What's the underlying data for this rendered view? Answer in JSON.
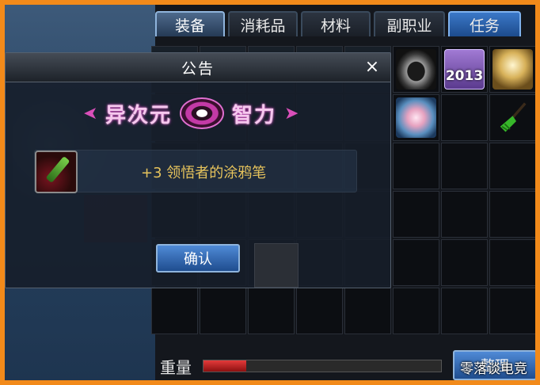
{
  "tabs": [
    {
      "label": "装备",
      "active": true
    },
    {
      "label": "消耗品",
      "active": false
    },
    {
      "label": "材料",
      "active": false
    },
    {
      "label": "副职业",
      "active": false
    },
    {
      "label": "任务",
      "active": false
    }
  ],
  "inventory": {
    "items": [
      "belt-icon",
      "badge-2013-icon",
      "trophy-icon",
      "orb-icon",
      "broom-icon"
    ],
    "badge_text": "2013"
  },
  "modal": {
    "title": "公告",
    "close_glyph": "×",
    "banner": {
      "left": "异次元",
      "right": "智力",
      "arrow_left": "➤",
      "arrow_right": "➤"
    },
    "reward_text": "+3 领悟者的涂鸦笔",
    "confirm_label": "确认"
  },
  "footer": {
    "weight_label": "重量",
    "weight_fraction": 0.18,
    "sort_label": "整理"
  },
  "watermark": "零落谈电竞",
  "colors": {
    "frame": "#f28a1a",
    "accent_blue": "#3b78c8",
    "reward_text": "#e6c35c",
    "weight_red": "#e43a3a"
  }
}
